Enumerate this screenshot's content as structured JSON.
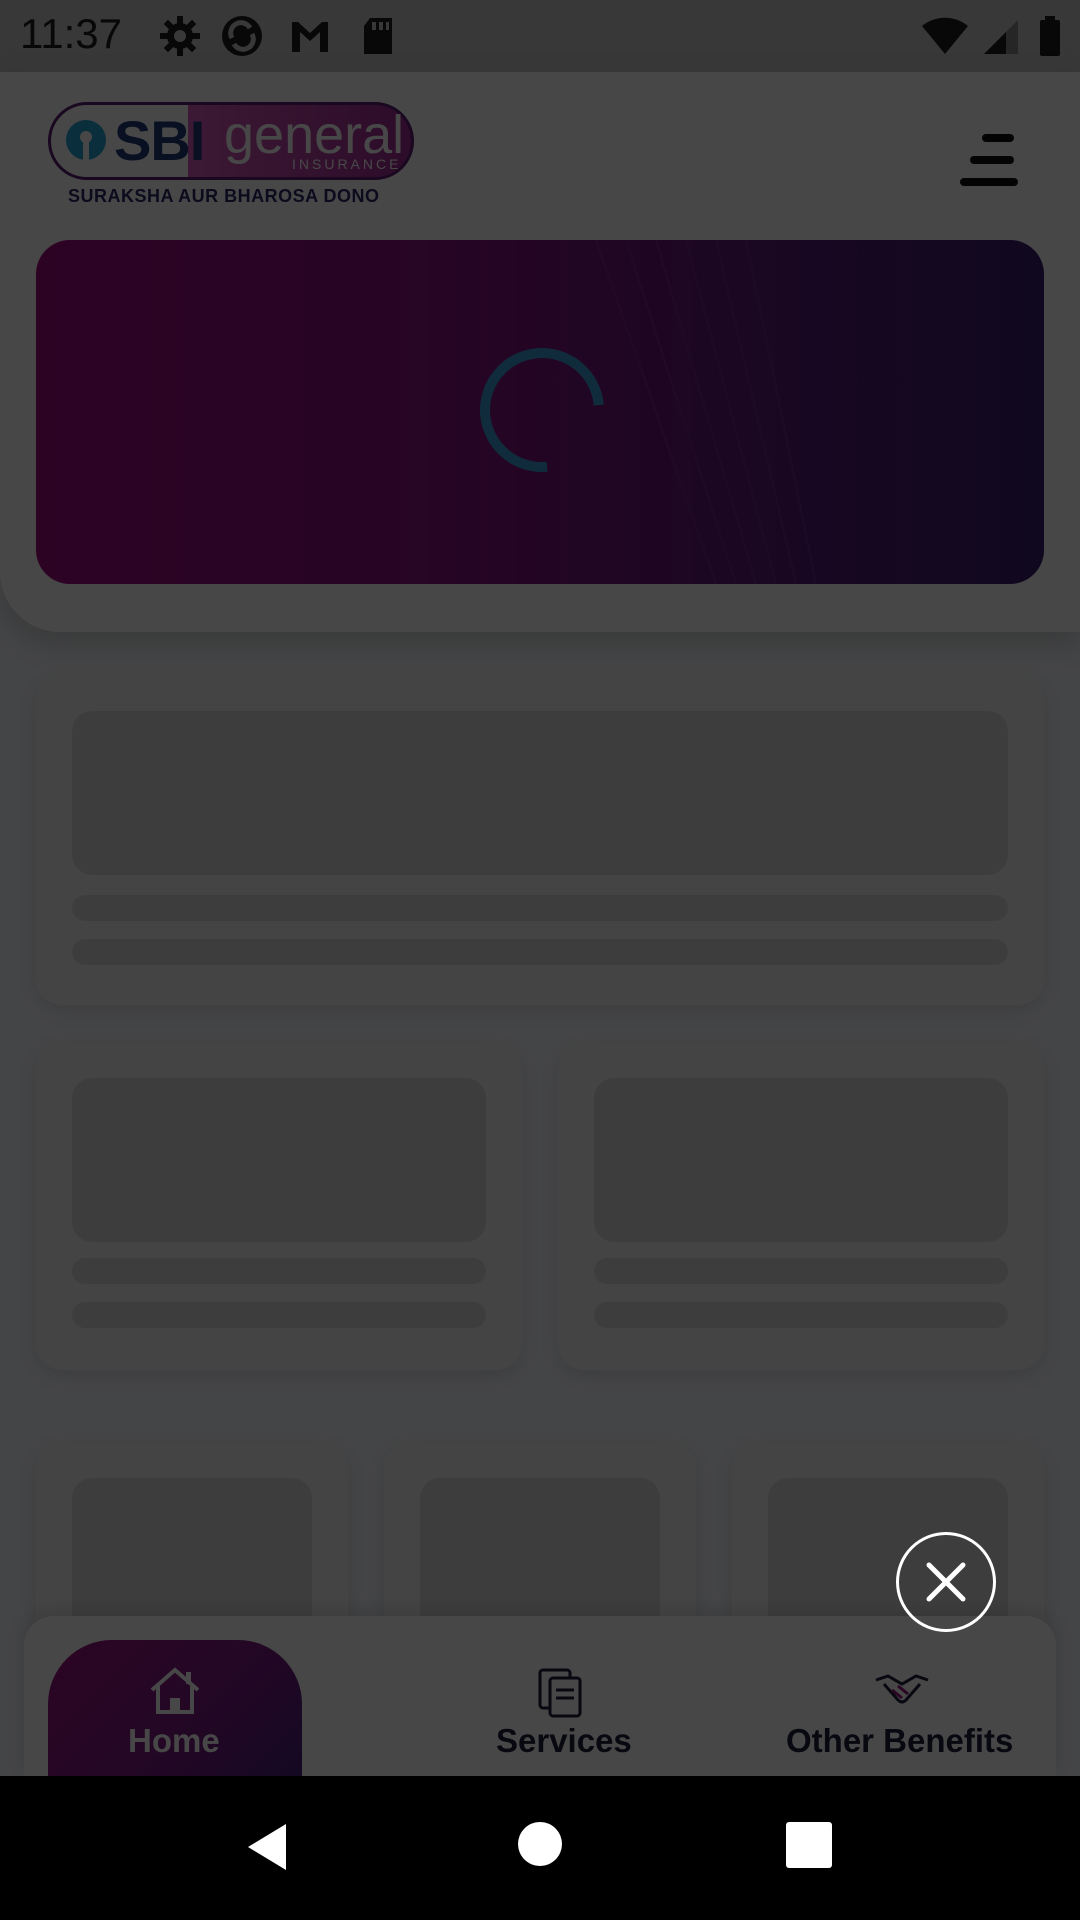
{
  "status_bar": {
    "time": "11:37",
    "icons_left": [
      "settings-icon",
      "sync-icon",
      "gmail-icon",
      "sd-card-icon"
    ],
    "icons_right": [
      "wifi-icon",
      "signal-icon",
      "battery-icon"
    ]
  },
  "header": {
    "logo": {
      "brand": "SBI",
      "product": "general",
      "sub": "INSURANCE",
      "tagline": "SURAKSHA AUR BHAROSA DONO"
    },
    "menu_icon": "hamburger-menu-icon"
  },
  "banner": {
    "state": "loading",
    "spinner_color": "#3a9fd8"
  },
  "bottom_nav": {
    "items": [
      {
        "label": "Home",
        "icon": "home-icon",
        "active": true
      },
      {
        "label": "Services",
        "icon": "documents-icon",
        "active": false
      },
      {
        "label": "Other Benefits",
        "icon": "handshake-icon",
        "active": false
      }
    ]
  },
  "overlay": {
    "close_icon": "close-icon"
  },
  "system_nav": {
    "buttons": [
      "back-icon",
      "home-circle-icon",
      "recents-icon"
    ]
  },
  "colors": {
    "brand_magenta": "#9c1483",
    "brand_purple": "#4a1f7e",
    "overlay_dim": "rgba(0,0,0,0.72)"
  }
}
